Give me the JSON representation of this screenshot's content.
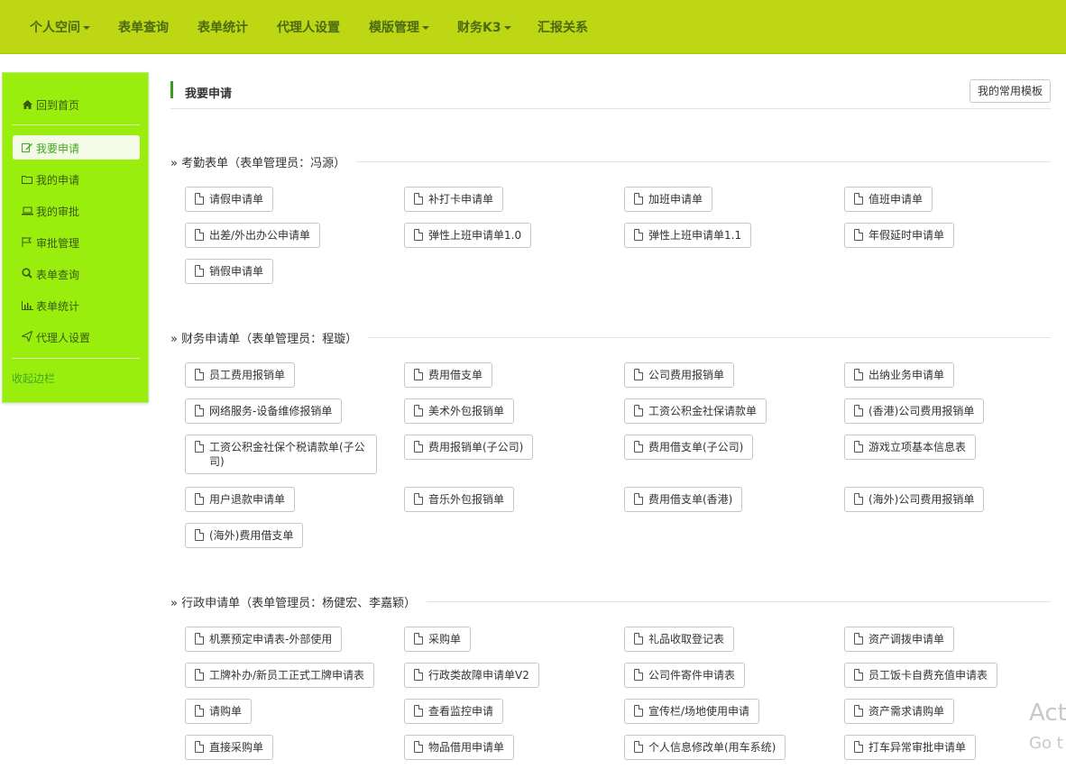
{
  "topnav": [
    {
      "label": "个人空间",
      "dropdown": true
    },
    {
      "label": "表单查询",
      "dropdown": false
    },
    {
      "label": "表单统计",
      "dropdown": false
    },
    {
      "label": "代理人设置",
      "dropdown": false
    },
    {
      "label": "模版管理",
      "dropdown": true
    },
    {
      "label": "财务K3",
      "dropdown": true
    },
    {
      "label": "汇报关系",
      "dropdown": false
    }
  ],
  "sidebar": {
    "home": {
      "label": "回到首页",
      "icon": "home-icon"
    },
    "items": [
      {
        "label": "我要申请",
        "icon": "edit-icon",
        "active": true
      },
      {
        "label": "我的申请",
        "icon": "folder-icon"
      },
      {
        "label": "我的审批",
        "icon": "laptop-icon"
      },
      {
        "label": "审批管理",
        "icon": "flag-icon"
      },
      {
        "label": "表单查询",
        "icon": "search-icon"
      },
      {
        "label": "表单统计",
        "icon": "bar-chart-icon"
      },
      {
        "label": "代理人设置",
        "icon": "send-icon"
      }
    ],
    "collapse_label": "收起边栏"
  },
  "main": {
    "title": "我要申请",
    "template_button": "我的常用模板",
    "sections": [
      {
        "title": "» 考勤表单（表单管理员：冯源）",
        "forms": [
          "请假申请单",
          "补打卡申请单",
          "加班申请单",
          "值班申请单",
          "出差/外出办公申请单",
          "弹性上班申请单1.0",
          "弹性上班申请单1.1",
          "年假延时申请单",
          "销假申请单"
        ]
      },
      {
        "title": "» 财务申请单（表单管理员：程璇）",
        "forms": [
          "员工费用报销单",
          "费用借支单",
          "公司费用报销单",
          "出纳业务申请单",
          "网络服务-设备维修报销单",
          "美术外包报销单",
          "工资公积金社保请款单",
          "(香港)公司费用报销单",
          "工资公积金社保个税请款单(子公司)",
          "费用报销单(子公司)",
          "费用借支单(子公司)",
          "游戏立项基本信息表",
          "用户退款申请单",
          "音乐外包报销单",
          "费用借支单(香港)",
          "(海外)公司费用报销单",
          "(海外)费用借支单"
        ]
      },
      {
        "title": "» 行政申请单（表单管理员：杨健宏、李嘉颖）",
        "forms": [
          "机票预定申请表-外部使用",
          "采购单",
          "礼品收取登记表",
          "资产调拨申请单",
          "工牌补办/新员工正式工牌申请表",
          "行政类故障申请单V2",
          "公司件寄件申请表",
          "员工饭卡自费充值申请表",
          "请购单",
          "查看监控申请",
          "宣传栏/场地使用申请",
          "资产需求请购单",
          "直接采购单",
          "物品借用申请单",
          "个人信息修改单(用车系统)",
          "打车异常审批申请单"
        ]
      }
    ]
  },
  "watermark": {
    "line1": "Act",
    "line2": "Go t"
  }
}
